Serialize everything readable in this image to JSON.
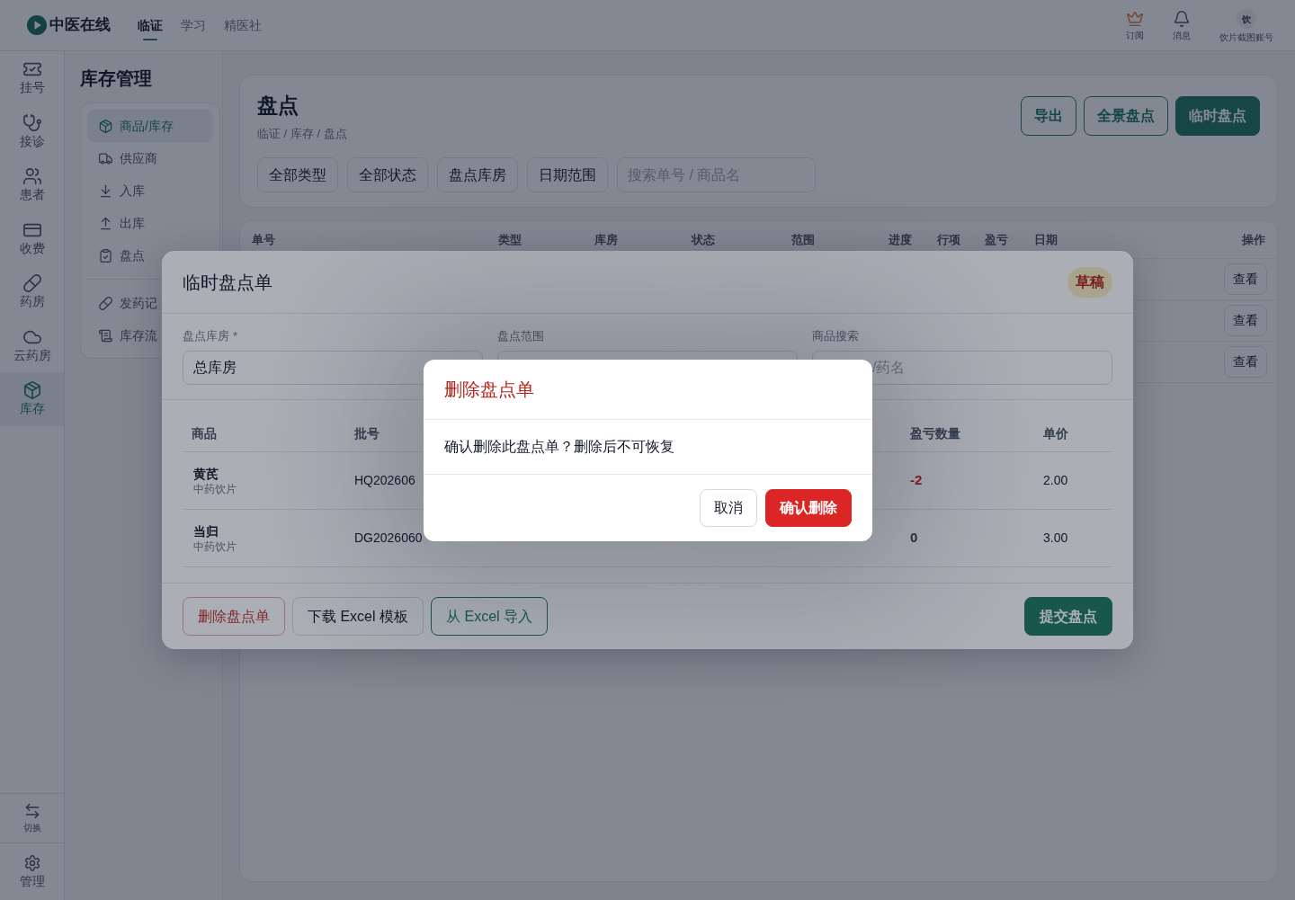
{
  "top_bar": {
    "logo_text": "中医在线",
    "nav_tabs": [
      {
        "label": "临证",
        "selected": true
      },
      {
        "label": "学习",
        "selected": false
      },
      {
        "label": "精医社",
        "selected": false
      }
    ],
    "actions": [
      {
        "kind": "crown",
        "label": "订阅"
      },
      {
        "kind": "bell",
        "label": "消息"
      },
      {
        "kind": "avatar",
        "avatar_text": "饮",
        "label": "饮片截图账号"
      }
    ]
  },
  "nav_rail": {
    "items": [
      {
        "kind": "ticket",
        "label": "挂号",
        "selected": false
      },
      {
        "kind": "stethoscope",
        "label": "接诊",
        "selected": false
      },
      {
        "kind": "users",
        "label": "患者",
        "selected": false
      },
      {
        "kind": "card",
        "label": "收费",
        "selected": false
      },
      {
        "kind": "pill",
        "label": "药房",
        "selected": false
      },
      {
        "kind": "cloud",
        "label": "云药房",
        "selected": false
      },
      {
        "kind": "package",
        "label": "库存",
        "selected": true
      }
    ],
    "bottom_items": [
      {
        "kind": "swap",
        "label": "切换"
      },
      {
        "kind": "gear",
        "label": "管理"
      }
    ]
  },
  "sidebar": {
    "title": "库存管理",
    "groups": [
      {
        "items": [
          {
            "kind": "package",
            "label": "商品/库存",
            "selected": true
          },
          {
            "kind": "truck",
            "label": "供应商",
            "selected": false
          },
          {
            "kind": "download",
            "label": "入库",
            "selected": false
          },
          {
            "kind": "upload",
            "label": "出库",
            "selected": false
          },
          {
            "kind": "clipboard",
            "label": "盘点",
            "selected": false
          }
        ]
      },
      {
        "items": [
          {
            "kind": "pill",
            "label": "发药记",
            "selected": false
          },
          {
            "kind": "scroll",
            "label": "库存流",
            "selected": false
          }
        ]
      }
    ]
  },
  "page": {
    "title": "盘点",
    "breadcrumb": "临证 / 库存 / 盘点",
    "actions": [
      {
        "kind": "outline",
        "label": "导出"
      },
      {
        "kind": "outline",
        "label": "全景盘点"
      },
      {
        "kind": "primary",
        "label": "临时盘点"
      }
    ],
    "filters": [
      "全部类型",
      "全部状态",
      "盘点库房",
      "日期范围"
    ],
    "search": {
      "placeholder": "搜索单号 / 商品名"
    },
    "table": {
      "columns": [
        "单号",
        "类型",
        "库房",
        "状态",
        "范围",
        "进度",
        "行项",
        "盈亏",
        "日期",
        "操作"
      ],
      "rows": [
        {
          "action": "查看"
        },
        {
          "action": "查看"
        },
        {
          "action": "查看"
        }
      ]
    }
  },
  "modal": {
    "title": "临时盘点单",
    "status": "草稿",
    "fields": [
      {
        "kind": "select",
        "label": "盘点库房",
        "required_mark": "*",
        "value": "总库房"
      },
      {
        "kind": "select",
        "label": "盘点范围"
      },
      {
        "kind": "search",
        "label": "商品搜索",
        "placeholder": "/药名"
      }
    ],
    "table": {
      "columns": [
        "商品",
        "批号",
        "盈亏数量",
        "单价"
      ],
      "rows": [
        {
          "name": "黄芪",
          "category": "中药饮片",
          "batch": "HQ202606",
          "diff": "-2",
          "diff_negative": true,
          "price": "2.00"
        },
        {
          "name": "当归",
          "category": "中药饮片",
          "batch": "DG2026060",
          "diff": "0",
          "diff_negative": false,
          "price": "3.00"
        }
      ]
    },
    "footer_buttons": [
      {
        "kind": "danger_outline",
        "label": "删除盘点单"
      },
      {
        "kind": "outline",
        "label": "下载 Excel 模板"
      },
      {
        "kind": "primary_outline",
        "label": "从 Excel 导入"
      },
      {
        "kind": "primary",
        "label": "提交盘点"
      }
    ]
  },
  "confirm_dialog": {
    "title": "删除盘点单",
    "message": "确认删除此盘点单？删除后不可恢复",
    "buttons": [
      {
        "kind": "cancel",
        "label": "取消"
      },
      {
        "kind": "danger",
        "label": "确认删除"
      }
    ]
  }
}
